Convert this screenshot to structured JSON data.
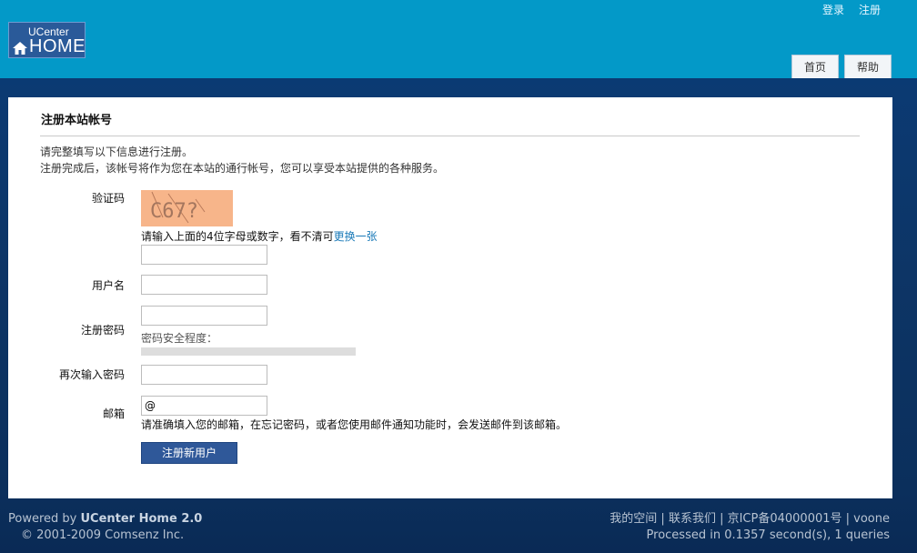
{
  "header": {
    "login_link": "登录",
    "register_link": "注册",
    "logo_small": "UCenter",
    "logo_big": "HOME",
    "nav": [
      "首页",
      "帮助"
    ]
  },
  "form": {
    "title": "注册本站帐号",
    "intro_line1": "请完整填写以下信息进行注册。",
    "intro_line2": "注册完成后，该帐号将作为您在本站的通行帐号，您可以享受本站提供的各种服务。",
    "captcha_label": "验证码",
    "captcha_text": "C67?",
    "captcha_hint": "请输入上面的4位字母或数字，看不清可",
    "captcha_refresh": "更换一张",
    "captcha_value": "",
    "username_label": "用户名",
    "username_value": "",
    "password_label": "注册密码",
    "password_value": "",
    "strength_label": "密码安全程度：",
    "confirm_label": "再次输入密码",
    "confirm_value": "",
    "email_label": "邮箱",
    "email_value": "@",
    "email_hint": "请准确填入您的邮箱，在忘记密码，或者您使用邮件通知功能时，会发送邮件到该邮箱。",
    "submit_label": "注册新用户"
  },
  "footer": {
    "powered_prefix": "Powered by ",
    "powered_name": "UCenter Home 2.0",
    "copyright": "© 2001-2009 Comsenz Inc.",
    "links": "我的空间 | 联系我们 | 京ICP备04000001号 | voone",
    "processed": "Processed in 0.1357 second(s), 1 queries"
  },
  "colors": {
    "header_bg": "#0399c8",
    "page_bg": "#0b2f5c",
    "button_bg": "#2f5899",
    "link": "#1a7ab8"
  }
}
